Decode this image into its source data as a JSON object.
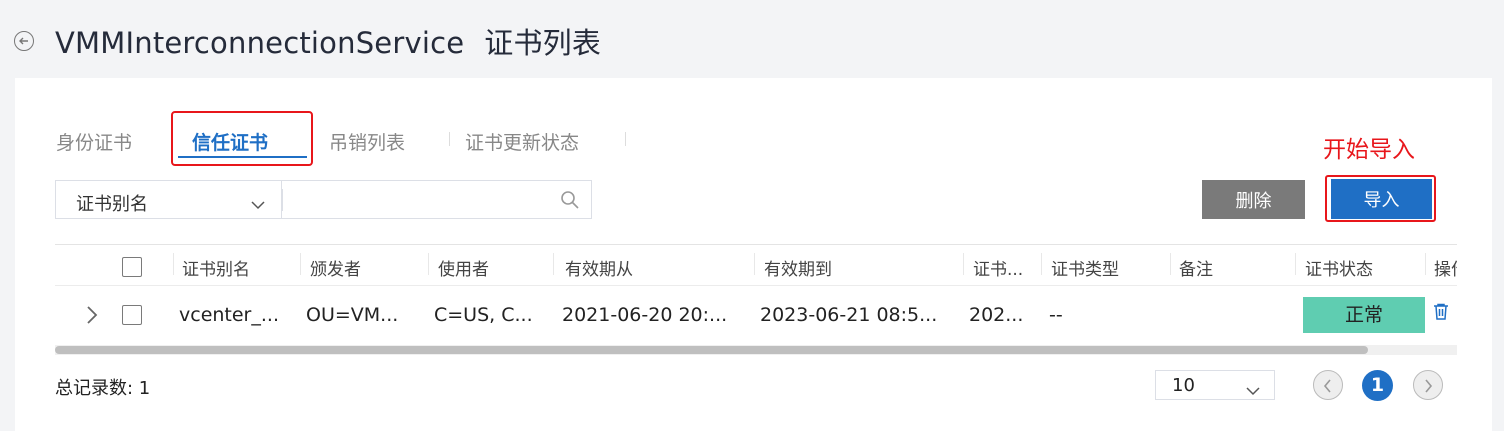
{
  "header": {
    "title": "VMMInterconnectionService",
    "subtitle": "证书列表"
  },
  "tabs": [
    {
      "label": "身份证书"
    },
    {
      "label": "信任证书",
      "active": true
    },
    {
      "label": "吊销列表"
    },
    {
      "label": "证书更新状态"
    }
  ],
  "annotation": {
    "text": "开始导入",
    "color": "#e8161b"
  },
  "filter": {
    "field": "证书别名",
    "value": "",
    "placeholder": ""
  },
  "toolbar": {
    "delete_label": "删除",
    "import_label": "导入"
  },
  "table": {
    "columns": [
      "证书别名",
      "颁发者",
      "使用者",
      "有效期从",
      "有效期到",
      "证书...",
      "证书类型",
      "备注",
      "证书状态",
      "操作"
    ],
    "rows": [
      {
        "alias": "vcenter_...",
        "issuer": "OU=VM...",
        "subject": "C=US, C...",
        "valid_from": "2021-06-20 20:...",
        "valid_to": "2023-06-21 08:5...",
        "cert": "202...",
        "type": "--",
        "note": "",
        "status": "正常"
      }
    ]
  },
  "pagination": {
    "total_label": "总记录数: 1",
    "page_size": "10",
    "current_page": "1"
  },
  "colors": {
    "accent": "#1f6fc5",
    "status_ok": "#5fcdb1",
    "delete_button": "#7a7a7a"
  }
}
